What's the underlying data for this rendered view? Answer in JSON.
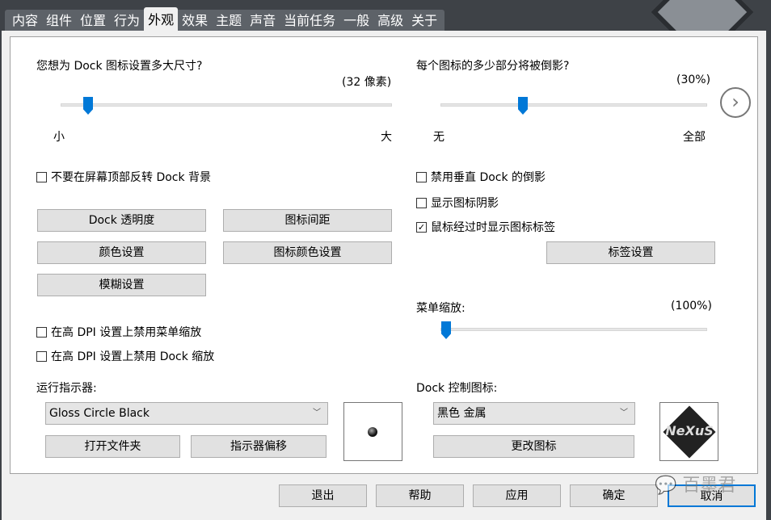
{
  "tabs": [
    "内容",
    "组件",
    "位置",
    "行为",
    "外观",
    "效果",
    "主题",
    "声音",
    "当前任务",
    "一般",
    "高级",
    "关于"
  ],
  "active_tab": "外观",
  "icon_size": {
    "label": "您想为 Dock 图标设置多大尺寸?",
    "value_text": "(32 像素)",
    "min_label": "小",
    "max_label": "大",
    "fraction": 0.08
  },
  "reflection": {
    "label": "每个图标的多少部分将被倒影?",
    "value_text": "(30%)",
    "min_label": "无",
    "max_label": "全部",
    "fraction": 0.3
  },
  "checkboxes_left": [
    {
      "label": "不要在屏幕顶部反转 Dock 背景",
      "checked": false
    }
  ],
  "checkboxes_right": [
    {
      "label": "禁用垂直 Dock 的倒影",
      "checked": false
    },
    {
      "label": "显示图标阴影",
      "checked": false
    },
    {
      "label": "鼠标经过时显示图标标签",
      "checked": true
    }
  ],
  "buttons": {
    "transparency": "Dock 透明度",
    "spacing": "图标间距",
    "color": "颜色设置",
    "icon_color": "图标颜色设置",
    "blur": "模糊设置",
    "label_settings": "标签设置",
    "open_folder": "打开文件夹",
    "indicator_offset": "指示器偏移",
    "change_icon": "更改图标"
  },
  "menu_zoom": {
    "label": "菜单缩放:",
    "value_text": "(100%)",
    "fraction": 0.0
  },
  "dpi_checkboxes": [
    {
      "label": "在高 DPI 设置上禁用菜单缩放",
      "checked": false
    },
    {
      "label": "在高 DPI 设置上禁用 Dock 缩放",
      "checked": false
    }
  ],
  "indicator": {
    "label": "运行指示器:",
    "selected": "Gloss Circle Black"
  },
  "dock_icon": {
    "label": "Dock 控制图标:",
    "selected": "黑色 金属",
    "logo_text": "NeXuS"
  },
  "footer": {
    "exit": "退出",
    "help": "帮助",
    "apply": "应用",
    "ok": "确定",
    "cancel": "取消"
  },
  "watermark": "百墨君",
  "accent": "#0078d7"
}
